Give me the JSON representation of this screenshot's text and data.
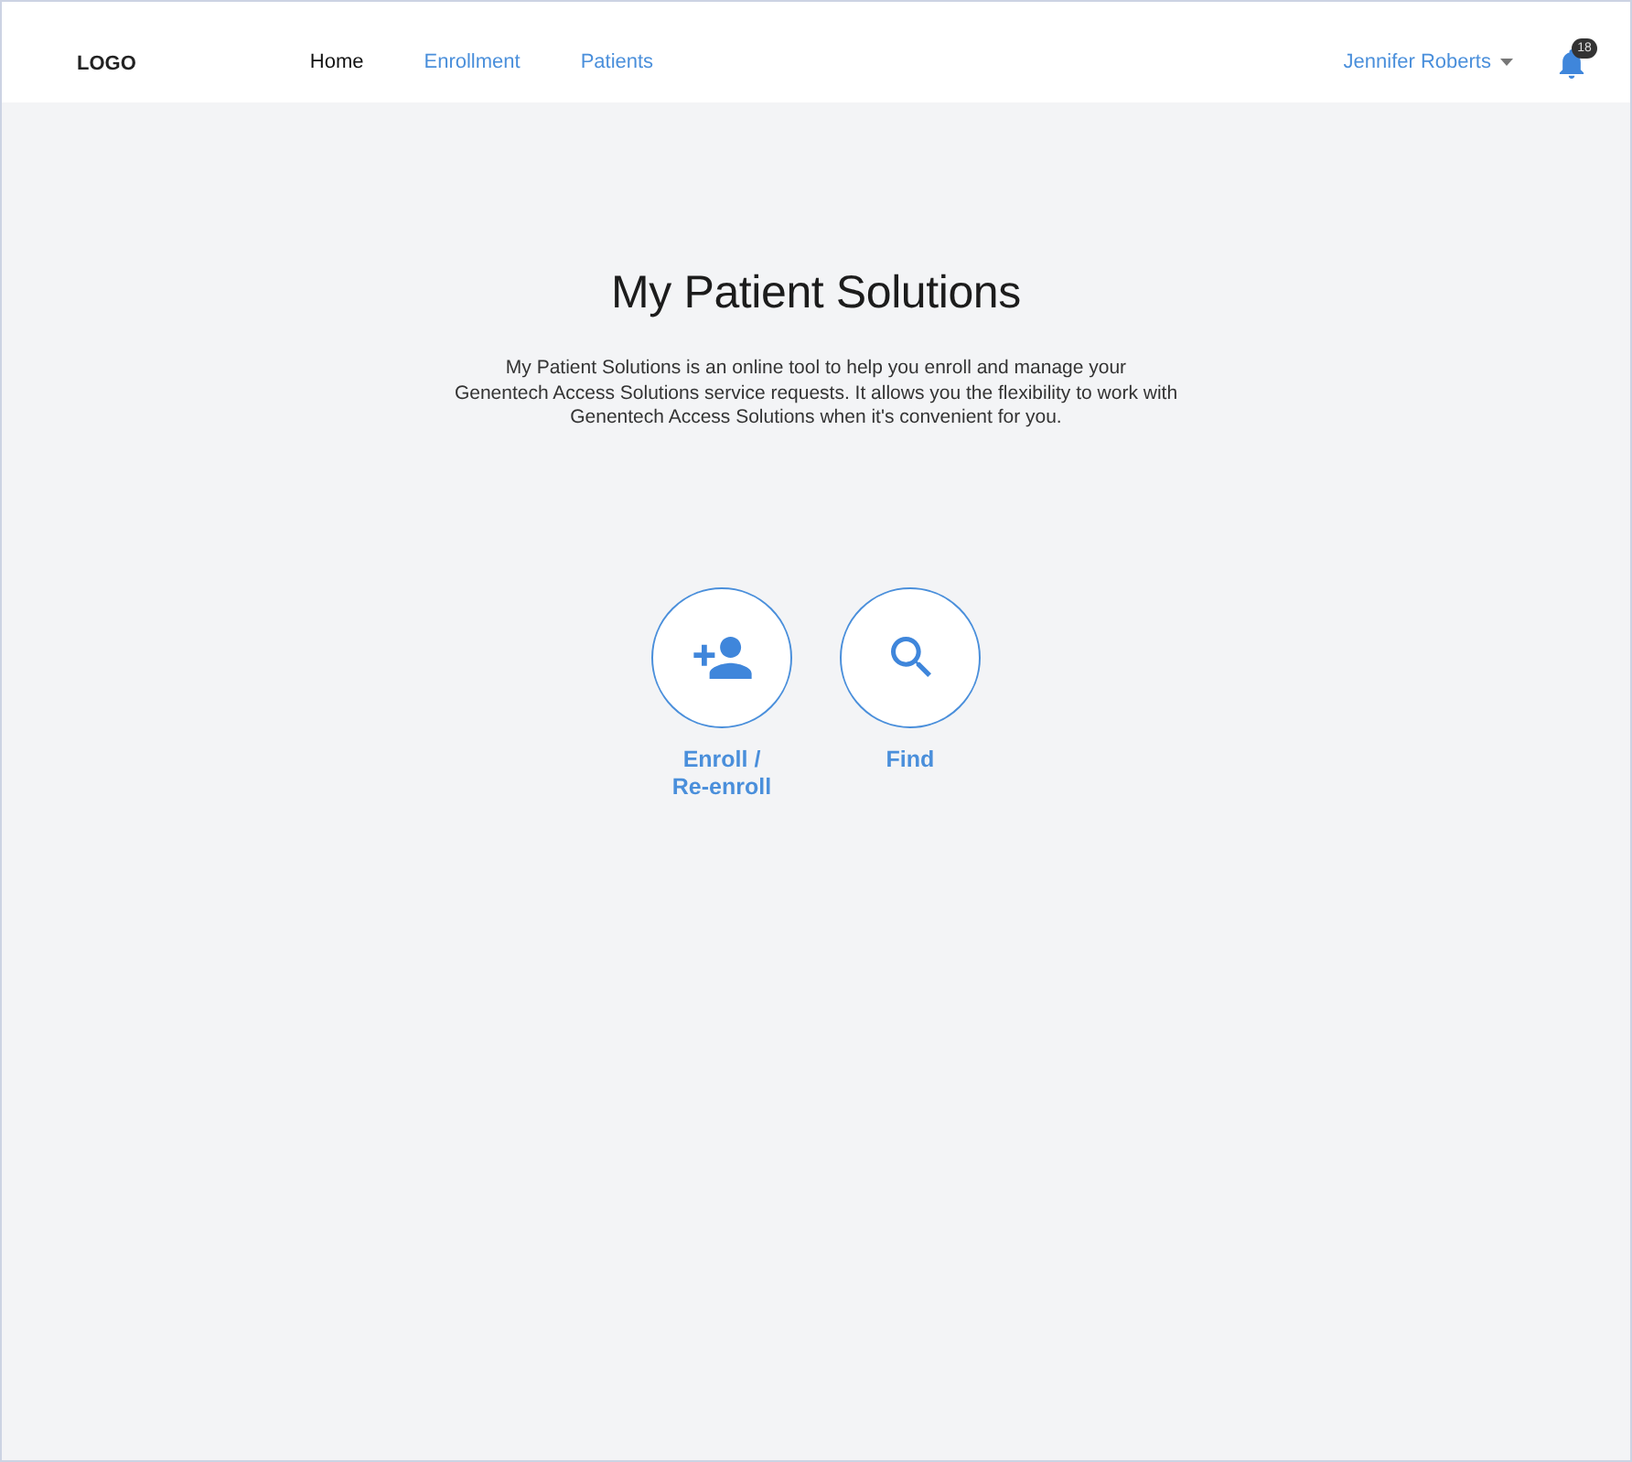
{
  "header": {
    "logo": "LOGO",
    "nav": [
      {
        "label": "Home",
        "selected": true
      },
      {
        "label": "Enrollment",
        "selected": false
      },
      {
        "label": "Patients",
        "selected": false
      }
    ],
    "user": {
      "name": "Jennifer Roberts"
    },
    "notifications": {
      "count": "18"
    }
  },
  "hero": {
    "title": "My Patient Solutions",
    "description": "My Patient Solutions is an online tool to help you enroll and manage your\nGenentech Access Solutions service requests. It allows you the flexibility to work with\nGenentech Access Solutions when it's convenient for you."
  },
  "actions": [
    {
      "kind": "enroll",
      "label": "Enroll / Re-enroll"
    },
    {
      "kind": "find",
      "label": "Find"
    }
  ]
}
